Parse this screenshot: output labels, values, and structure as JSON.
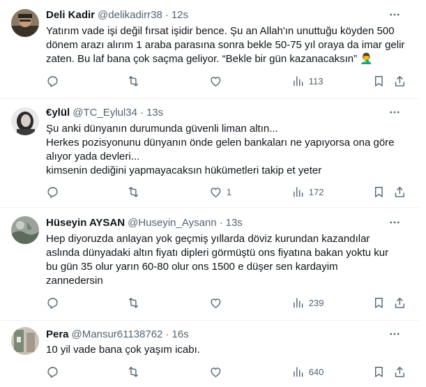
{
  "tweets": [
    {
      "name": "Deli Kadir",
      "handle": "@delikadirr38",
      "sep": "·",
      "time": "12s",
      "lines": [
        "Yatırım vade işi değil fırsat işidir bence. Şu an Allah'ın unuttuğu köyden 500",
        "dönem arazı alırım 1 araba parasına sonra bekle 50-75 yıl oraya da imar gelir",
        "zaten. Bu laf bana çok saçma geliyor. “Bekle bir gün kazanacaksın” 🤦‍♂️"
      ],
      "replies": "",
      "retweets": "",
      "likes": "",
      "views": "113"
    },
    {
      "name": "€ylül",
      "handle": "@TC_Eylul34",
      "sep": "·",
      "time": "13s",
      "lines": [
        "Şu anki dünyanın durumunda güvenli liman altın...",
        "Herkes pozisyonunu dünyanın önde gelen bankaları ne yapıyorsa ona göre",
        "alıyor yada devleri...",
        "kimsenin dediğini yapmayacaksın hükümetleri takip et yeter"
      ],
      "replies": "",
      "retweets": "",
      "likes": "1",
      "views": "172"
    },
    {
      "name": "Hüseyin AYSAN",
      "handle": "@Huseyin_Aysann",
      "sep": "·",
      "time": "13s",
      "lines": [
        "Hep diyoruzda anlayan yok geçmiş yıllarda döviz kurundan kazandılar",
        "aslında dünyadaki altın fiyatı dipleri görmüştü ons fiyatına bakan yoktu kur",
        "bu gün 35 olur yarın 60-80 olur ons 1500 e düşer sen kardayim",
        "zannedersin"
      ],
      "replies": "",
      "retweets": "",
      "likes": "",
      "views": "239"
    },
    {
      "name": "Pera",
      "handle": "@Mansur61138762",
      "sep": "·",
      "time": "16s",
      "lines": [
        "10 yil vade bana çok yaşım icabı."
      ],
      "replies": "",
      "retweets": "",
      "likes": "",
      "views": "640"
    }
  ],
  "icons": {
    "reply": "reply-icon",
    "retweet": "retweet-icon",
    "like": "heart-icon",
    "views": "views-icon",
    "bookmark": "bookmark-icon",
    "share": "share-icon",
    "more": "more-icon"
  },
  "colors": {
    "text": "#0f1419",
    "secondary": "#536471",
    "divider": "#eff3f4"
  }
}
